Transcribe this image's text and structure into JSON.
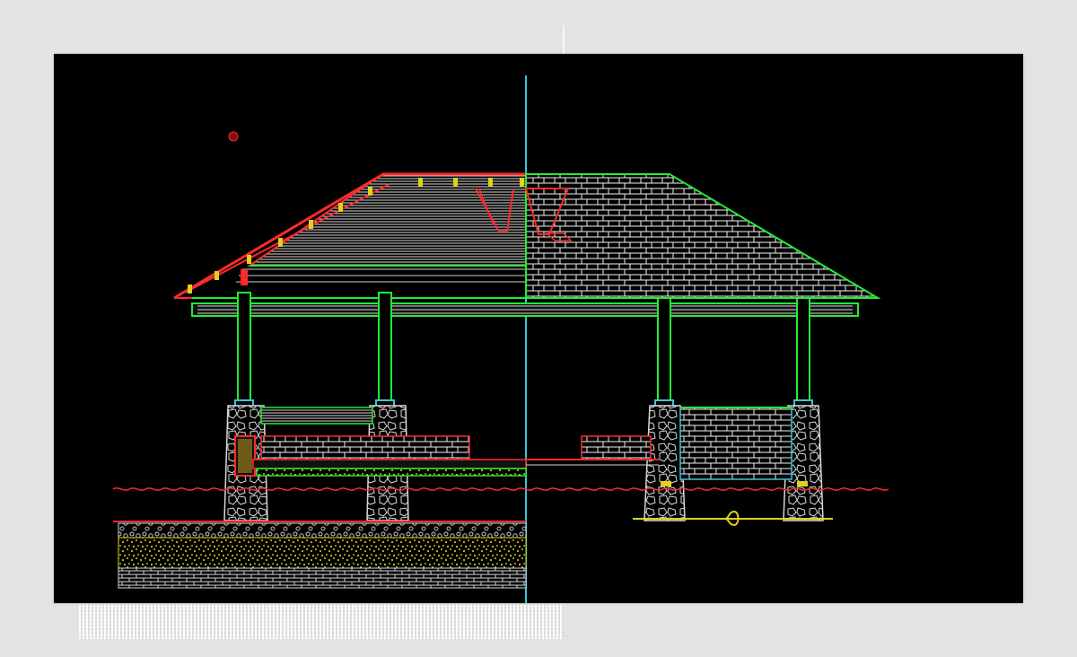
{
  "colors": {
    "background": "#000000",
    "page": "#e3e3e3",
    "red": "#ff2a2a",
    "green": "#22ee33",
    "cyan": "#35c8d8",
    "white": "#f2f2f2",
    "yellow": "#e0d21d",
    "stone_fill": "#d6d6d6"
  },
  "drawing": {
    "type": "architectural-section-elevation",
    "subject": "pavilion",
    "left_half": "section",
    "right_half": "elevation",
    "columns_visible": 4,
    "benches_visible": 2
  },
  "watermark": {
    "text": ""
  }
}
